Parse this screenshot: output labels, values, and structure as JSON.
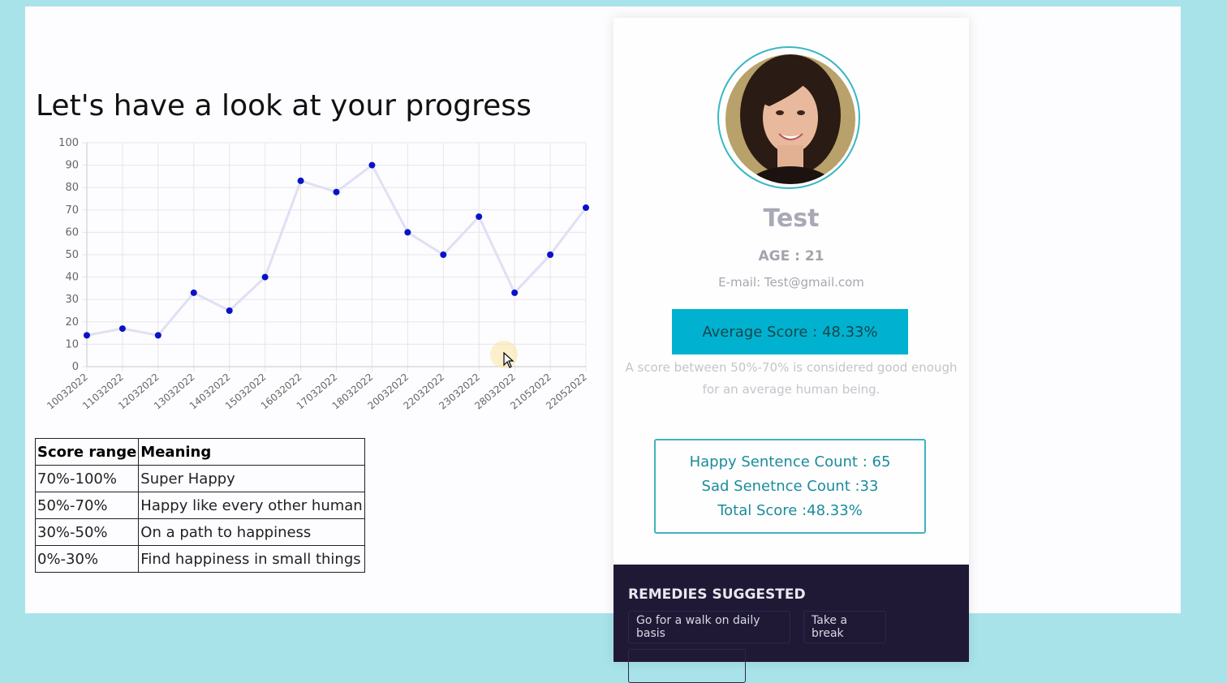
{
  "progress": {
    "title": "Let's have a look at your progress"
  },
  "chart_data": {
    "type": "line",
    "title": "",
    "xlabel": "",
    "ylabel": "",
    "categories": [
      "10032022",
      "11032022",
      "12032022",
      "13032022",
      "14032022",
      "15032022",
      "16032022",
      "17032022",
      "18032022",
      "20032022",
      "22032022",
      "23032022",
      "28032022",
      "21052022",
      "22052022"
    ],
    "series": [
      {
        "values": [
          14,
          17,
          14,
          33,
          25,
          40,
          83,
          78,
          90,
          60,
          50,
          67,
          33,
          50,
          71
        ]
      }
    ],
    "ylim": [
      0,
      100
    ],
    "yticks": [
      0,
      10,
      20,
      30,
      40,
      50,
      60,
      70,
      80,
      90,
      100
    ],
    "grid": true,
    "legend": "none",
    "line_color": "#e0e0f4",
    "point_color": "#0a12c8"
  },
  "score_table": {
    "headers": [
      "Score range",
      "Meaning"
    ],
    "rows": [
      [
        "70%-100%",
        "Super Happy"
      ],
      [
        "50%-70%",
        "Happy like every other human"
      ],
      [
        "30%-50%",
        "On a path to happiness"
      ],
      [
        "0%-30%",
        "Find happiness in small things"
      ]
    ]
  },
  "profile": {
    "name": "Test",
    "age": "AGE : 21",
    "email": "E-mail: Test@gmail.com",
    "avg_score_label": "Average Score : 48.33%",
    "note_line1": "A score between 50%-70% is considered good enough",
    "note_line2": "for an average human being.",
    "stats": {
      "happy": "Happy Sentence Count : 65",
      "sad": "Sad Senetnce Count :33",
      "total": "Total Score :48.33%"
    }
  },
  "remedies": {
    "title": "REMEDIES SUGGESTED",
    "items": [
      "Go for a walk on daily basis",
      "Take a break"
    ]
  },
  "colors": {
    "background": "#a8e3ea",
    "accent": "#00b2cf",
    "remedies_bg": "#1f1936"
  }
}
